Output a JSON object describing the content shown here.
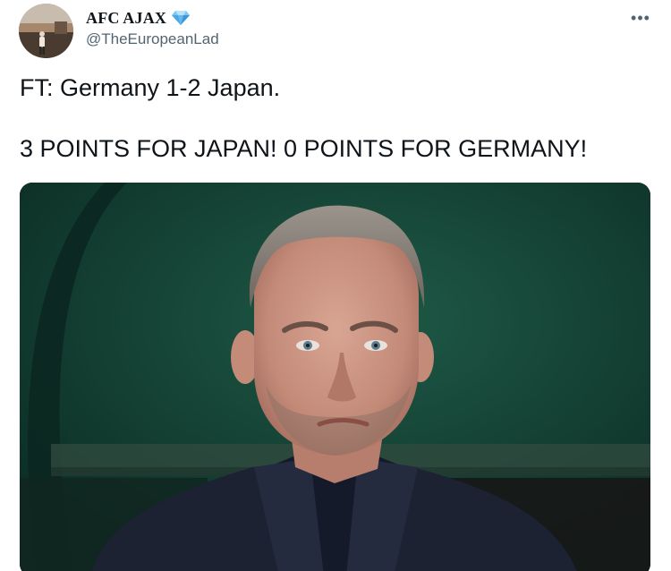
{
  "tweet": {
    "author": {
      "display_name": "AFC AJAX",
      "verified_emoji_icon": "gem-stone-icon",
      "handle": "@TheEuropeanLad"
    },
    "more_icon": "more-horizontal-icon",
    "more_label": "•••",
    "text_lines": [
      "FT: Germany 1-2 Japan.",
      "3 POINTS FOR JAPAN! 0 POINTS FOR GERMANY!"
    ],
    "media": {
      "type": "photo",
      "colors": {
        "background": "#103a2f",
        "jacket": "#1d2233",
        "skin": "#c99482"
      }
    }
  }
}
